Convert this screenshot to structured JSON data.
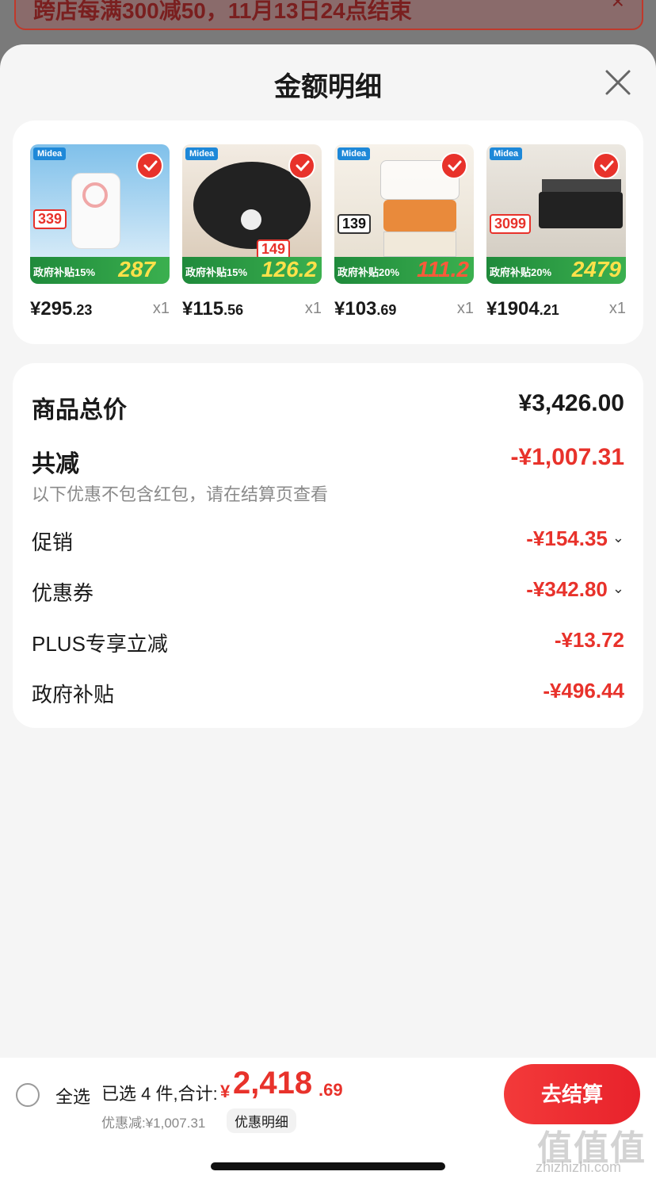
{
  "background": {
    "banner_text": "跨店每满300减50，11月13日24点结束",
    "banner_close": "×"
  },
  "sheet": {
    "title": "金额明细"
  },
  "products": [
    {
      "price_int": "¥295",
      "price_dec": ".23",
      "qty": "x1",
      "brand": "Midea",
      "band_text": "政府补贴15%",
      "band_price": "287",
      "tag": "339"
    },
    {
      "price_int": "¥115",
      "price_dec": ".56",
      "qty": "x1",
      "brand": "Midea",
      "band_text": "政府补贴15%",
      "band_price": "126.2",
      "tag": "149"
    },
    {
      "price_int": "¥103",
      "price_dec": ".69",
      "qty": "x1",
      "brand": "Midea",
      "band_text": "政府补贴20%",
      "band_price": "111.2",
      "tag": "139"
    },
    {
      "price_int": "¥1904",
      "price_dec": ".21",
      "qty": "x1",
      "brand": "Midea",
      "band_text": "政府补贴20%",
      "band_price": "2479",
      "tag": "3099"
    }
  ],
  "detail": {
    "total_label": "商品总价",
    "total_value": "¥3,426.00",
    "reduce_label": "共减",
    "reduce_value": "-¥1,007.31",
    "note": "以下优惠不包含红包，请在结算页查看",
    "items": [
      {
        "label": "促销",
        "value": "-¥154.35"
      },
      {
        "label": "优惠券",
        "value": "-¥342.80"
      },
      {
        "label": "PLUS专享立减",
        "value": "-¥13.72"
      },
      {
        "label": "政府补贴",
        "value": "-¥496.44"
      }
    ]
  },
  "bottom": {
    "select_all": "全选",
    "selected": "已选 4 件,合计:",
    "total_symbol": "¥",
    "total_int": "2,418",
    "total_dec": ".69",
    "discount": "优惠减:¥1,007.31",
    "discount_link": "优惠明细",
    "checkout": "去结算"
  },
  "watermark": {
    "main": "值值值",
    "sub": "zhizhizhi.com"
  },
  "colors": {
    "accent": "#e8322b",
    "card": "#ffffff",
    "sheet_bg": "#f5f5f5"
  }
}
